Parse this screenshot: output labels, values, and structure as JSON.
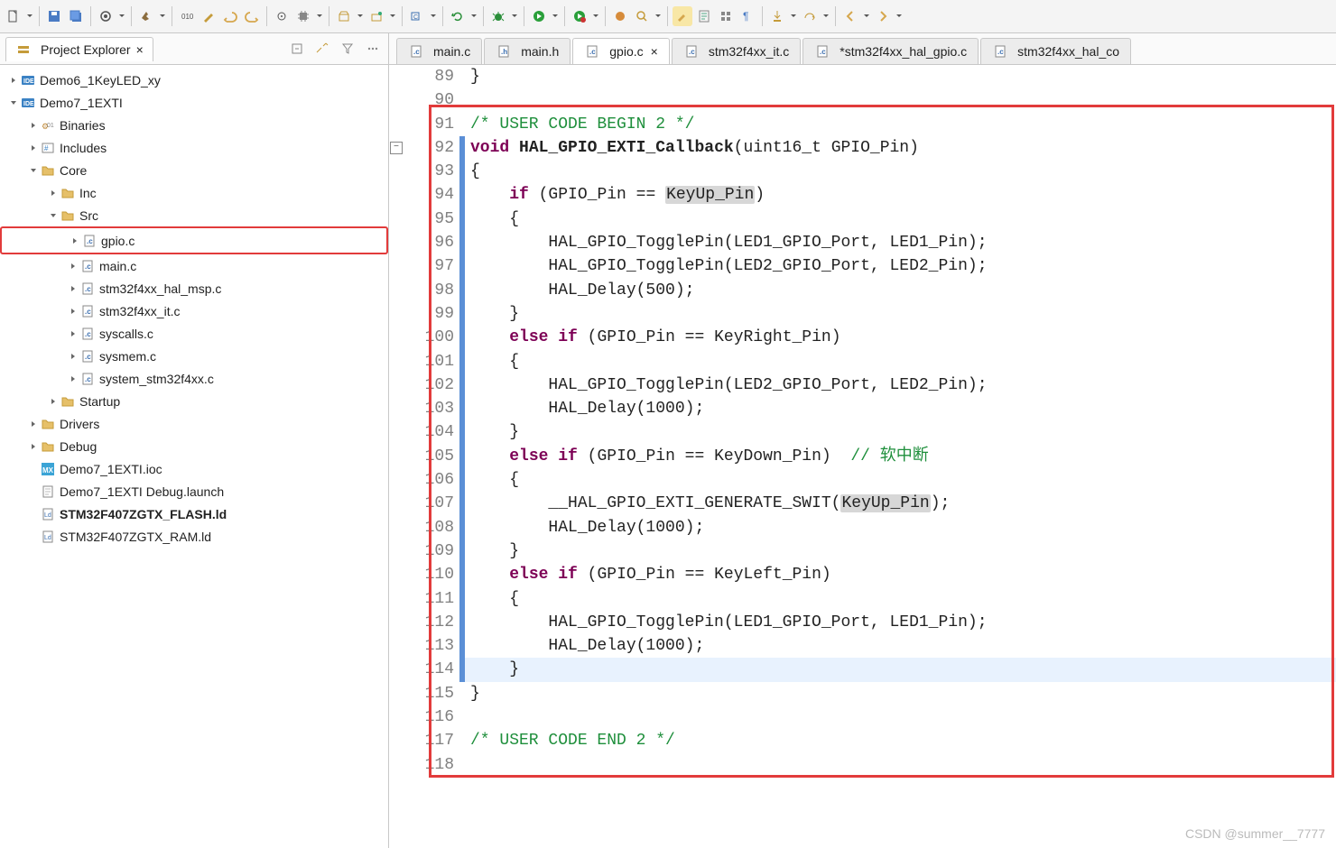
{
  "explorer": {
    "title": "Project Explorer",
    "tree": [
      {
        "label": "Demo6_1KeyLED_xy",
        "indent": 0,
        "icon": "ide",
        "expand": "closed"
      },
      {
        "label": "Demo7_1EXTI",
        "indent": 0,
        "icon": "ide",
        "expand": "open"
      },
      {
        "label": "Binaries",
        "indent": 1,
        "icon": "bin",
        "expand": "closed"
      },
      {
        "label": "Includes",
        "indent": 1,
        "icon": "inc",
        "expand": "closed"
      },
      {
        "label": "Core",
        "indent": 1,
        "icon": "folder",
        "expand": "open"
      },
      {
        "label": "Inc",
        "indent": 2,
        "icon": "folder",
        "expand": "closed"
      },
      {
        "label": "Src",
        "indent": 2,
        "icon": "folder",
        "expand": "open"
      },
      {
        "label": "gpio.c",
        "indent": 3,
        "icon": "cfile",
        "expand": "closed",
        "selected": true
      },
      {
        "label": "main.c",
        "indent": 3,
        "icon": "cfile",
        "expand": "closed"
      },
      {
        "label": "stm32f4xx_hal_msp.c",
        "indent": 3,
        "icon": "cfile",
        "expand": "closed"
      },
      {
        "label": "stm32f4xx_it.c",
        "indent": 3,
        "icon": "cfile",
        "expand": "closed"
      },
      {
        "label": "syscalls.c",
        "indent": 3,
        "icon": "cfile",
        "expand": "closed"
      },
      {
        "label": "sysmem.c",
        "indent": 3,
        "icon": "cfile",
        "expand": "closed"
      },
      {
        "label": "system_stm32f4xx.c",
        "indent": 3,
        "icon": "cfile",
        "expand": "closed"
      },
      {
        "label": "Startup",
        "indent": 2,
        "icon": "folder",
        "expand": "closed"
      },
      {
        "label": "Drivers",
        "indent": 1,
        "icon": "folder",
        "expand": "closed"
      },
      {
        "label": "Debug",
        "indent": 1,
        "icon": "folder",
        "expand": "closed"
      },
      {
        "label": "Demo7_1EXTI.ioc",
        "indent": 1,
        "icon": "mx",
        "expand": "none"
      },
      {
        "label": "Demo7_1EXTI Debug.launch",
        "indent": 1,
        "icon": "file",
        "expand": "none"
      },
      {
        "label": "STM32F407ZGTX_FLASH.ld",
        "indent": 1,
        "icon": "ld",
        "expand": "none",
        "bold": true
      },
      {
        "label": "STM32F407ZGTX_RAM.ld",
        "indent": 1,
        "icon": "ld",
        "expand": "none"
      }
    ]
  },
  "tabs": [
    {
      "label": "main.c",
      "icon": "cfile"
    },
    {
      "label": "main.h",
      "icon": "hfile"
    },
    {
      "label": "gpio.c",
      "icon": "cfile",
      "active": true,
      "closeable": true
    },
    {
      "label": "stm32f4xx_it.c",
      "icon": "cfile"
    },
    {
      "label": "*stm32f4xx_hal_gpio.c",
      "icon": "cfile"
    },
    {
      "label": "stm32f4xx_hal_co",
      "icon": "cfile"
    }
  ],
  "code": {
    "first_line": 89,
    "lines": [
      {
        "n": 89,
        "html": "}"
      },
      {
        "n": 90,
        "html": ""
      },
      {
        "n": 91,
        "html": "<span class='cm'>/* USER CODE BEGIN 2 */</span>"
      },
      {
        "n": 92,
        "html": "<span class='kw'>void</span> <span class='bfn'>HAL_GPIO_EXTI_Callback</span>(uint16_t GPIO_Pin)",
        "fold": true,
        "mod": true
      },
      {
        "n": 93,
        "html": "{",
        "mod": true
      },
      {
        "n": 94,
        "html": "    <span class='kw'>if</span> (GPIO_Pin == <span class='hl'>KeyUp_Pin</span>)",
        "mod": true
      },
      {
        "n": 95,
        "html": "    {",
        "mod": true
      },
      {
        "n": 96,
        "html": "        HAL_GPIO_TogglePin(LED1_GPIO_Port, LED1_Pin);",
        "mod": true
      },
      {
        "n": 97,
        "html": "        HAL_GPIO_TogglePin(LED2_GPIO_Port, LED2_Pin);",
        "mod": true
      },
      {
        "n": 98,
        "html": "        HAL_Delay(500);",
        "mod": true
      },
      {
        "n": 99,
        "html": "    }",
        "mod": true
      },
      {
        "n": 100,
        "html": "    <span class='kw'>else</span> <span class='kw'>if</span> (GPIO_Pin == KeyRight_Pin)",
        "mod": true
      },
      {
        "n": 101,
        "html": "    {",
        "mod": true
      },
      {
        "n": 102,
        "html": "        HAL_GPIO_TogglePin(LED2_GPIO_Port, LED2_Pin);",
        "mod": true
      },
      {
        "n": 103,
        "html": "        HAL_Delay(1000);",
        "mod": true
      },
      {
        "n": 104,
        "html": "    }",
        "mod": true
      },
      {
        "n": 105,
        "html": "    <span class='kw'>else</span> <span class='kw'>if</span> (GPIO_Pin == KeyDown_Pin)  <span class='cm'>// 软中断</span>",
        "mod": true
      },
      {
        "n": 106,
        "html": "    {",
        "mod": true
      },
      {
        "n": 107,
        "html": "        __HAL_GPIO_EXTI_GENERATE_SWIT(<span class='hl'>KeyUp_Pin</span>);",
        "mod": true
      },
      {
        "n": 108,
        "html": "        HAL_Delay(1000);",
        "mod": true
      },
      {
        "n": 109,
        "html": "    }",
        "mod": true
      },
      {
        "n": 110,
        "html": "    <span class='kw'>else</span> <span class='kw'>if</span> (GPIO_Pin == KeyLeft_Pin)",
        "mod": true
      },
      {
        "n": 111,
        "html": "    {",
        "mod": true
      },
      {
        "n": 112,
        "html": "        HAL_GPIO_TogglePin(LED1_GPIO_Port, LED1_Pin);",
        "mod": true
      },
      {
        "n": 113,
        "html": "        HAL_Delay(1000);",
        "mod": true
      },
      {
        "n": 114,
        "html": "    }",
        "mod": true,
        "current": true
      },
      {
        "n": 115,
        "html": "}"
      },
      {
        "n": 116,
        "html": ""
      },
      {
        "n": 117,
        "html": "<span class='cm'>/* USER CODE END 2 */</span>"
      },
      {
        "n": 118,
        "html": ""
      }
    ]
  },
  "watermark": "CSDN @summer__7777"
}
